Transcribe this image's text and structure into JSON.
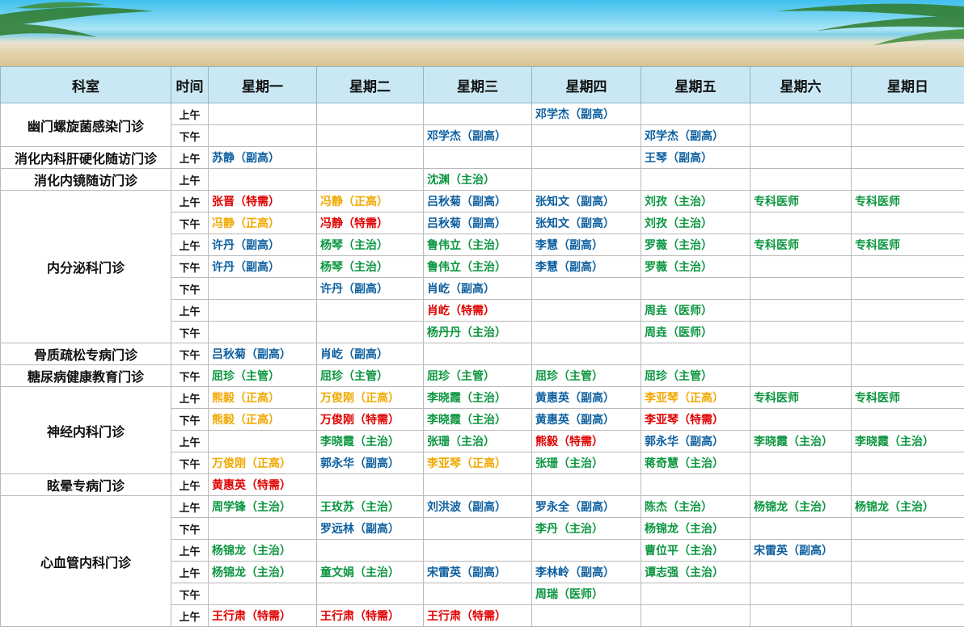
{
  "colors": {
    "red": "#e00000",
    "blue": "#0c5f9f",
    "green": "#0c9640",
    "gold": "#f0a800",
    "header_bg": "#c9e8f3"
  },
  "headers": [
    "科室",
    "时间",
    "星期一",
    "星期二",
    "星期三",
    "星期四",
    "星期五",
    "星期六",
    "星期日"
  ],
  "departments": [
    {
      "name": "幽门螺旋菌感染门诊",
      "rows": [
        {
          "time": "上午",
          "cells": [
            null,
            null,
            null,
            [
              "邓学杰（副高）",
              "blue"
            ],
            null,
            null,
            null
          ]
        },
        {
          "time": "下午",
          "cells": [
            null,
            null,
            [
              "邓学杰（副高）",
              "blue"
            ],
            null,
            [
              "邓学杰（副高）",
              "blue"
            ],
            null,
            null
          ]
        }
      ]
    },
    {
      "name": "消化内科肝硬化随访门诊",
      "rows": [
        {
          "time": "上午",
          "cells": [
            [
              "苏静（副高）",
              "blue"
            ],
            null,
            null,
            null,
            [
              "王琴（副高）",
              "blue"
            ],
            null,
            null
          ]
        }
      ]
    },
    {
      "name": "消化内镜随访门诊",
      "rows": [
        {
          "time": "上午",
          "cells": [
            null,
            null,
            [
              "沈渊（主治）",
              "green"
            ],
            null,
            null,
            null,
            null
          ]
        }
      ]
    },
    {
      "name": "内分泌科门诊",
      "rows": [
        {
          "time": "上午",
          "cells": [
            [
              "张晋（特需）",
              "red"
            ],
            [
              "冯静（正高）",
              "gold"
            ],
            [
              "吕秋菊（副高）",
              "blue"
            ],
            [
              "张知文（副高）",
              "blue"
            ],
            [
              "刘孜（主治）",
              "green"
            ],
            [
              "专科医师",
              "green"
            ],
            [
              "专科医师",
              "green"
            ]
          ]
        },
        {
          "time": "下午",
          "cells": [
            [
              "冯静（正高）",
              "gold"
            ],
            [
              "冯静（特需）",
              "red"
            ],
            [
              "吕秋菊（副高）",
              "blue"
            ],
            [
              "张知文（副高）",
              "blue"
            ],
            [
              "刘孜（主治）",
              "green"
            ],
            null,
            null
          ]
        },
        {
          "time": "上午",
          "cells": [
            [
              "许丹（副高）",
              "blue"
            ],
            [
              "杨琴（主治）",
              "green"
            ],
            [
              "鲁伟立（主治）",
              "green"
            ],
            [
              "李慧（副高）",
              "blue"
            ],
            [
              "罗薇（主治）",
              "green"
            ],
            [
              "专科医师",
              "green"
            ],
            [
              "专科医师",
              "green"
            ]
          ]
        },
        {
          "time": "下午",
          "cells": [
            [
              "许丹（副高）",
              "blue"
            ],
            [
              "杨琴（主治）",
              "green"
            ],
            [
              "鲁伟立（主治）",
              "green"
            ],
            [
              "李慧（副高）",
              "blue"
            ],
            [
              "罗薇（主治）",
              "green"
            ],
            null,
            null
          ]
        },
        {
          "time": "下午",
          "cells": [
            null,
            [
              "许丹（副高）",
              "blue"
            ],
            [
              "肖屹（副高）",
              "blue"
            ],
            null,
            null,
            null,
            null
          ]
        },
        {
          "time": "上午",
          "cells": [
            null,
            null,
            [
              "肖屹（特需）",
              "red"
            ],
            null,
            [
              "周垚（医师）",
              "green"
            ],
            null,
            null
          ]
        },
        {
          "time": "下午",
          "cells": [
            null,
            null,
            [
              "杨丹丹（主治）",
              "green"
            ],
            null,
            [
              "周垚（医师）",
              "green"
            ],
            null,
            null
          ]
        }
      ]
    },
    {
      "name": "骨质疏松专病门诊",
      "rows": [
        {
          "time": "下午",
          "cells": [
            [
              "吕秋菊（副高）",
              "blue"
            ],
            [
              "肖屹（副高）",
              "blue"
            ],
            null,
            null,
            null,
            null,
            null
          ]
        }
      ]
    },
    {
      "name": "糖尿病健康教育门诊",
      "rows": [
        {
          "time": "下午",
          "cells": [
            [
              "屈珍（主管）",
              "green"
            ],
            [
              "屈珍（主管）",
              "green"
            ],
            [
              "屈珍（主管）",
              "green"
            ],
            [
              "屈珍（主管）",
              "green"
            ],
            [
              "屈珍（主管）",
              "green"
            ],
            null,
            null
          ]
        }
      ]
    },
    {
      "name": "神经内科门诊",
      "rows": [
        {
          "time": "上午",
          "cells": [
            [
              "熊毅（正高）",
              "gold"
            ],
            [
              "万俊刚（正高）",
              "gold"
            ],
            [
              "李晓霞（主治）",
              "green"
            ],
            [
              "黄惠英（副高）",
              "blue"
            ],
            [
              "李亚琴（正高）",
              "gold"
            ],
            [
              "专科医师",
              "green"
            ],
            [
              "专科医师",
              "green"
            ]
          ]
        },
        {
          "time": "下午",
          "cells": [
            [
              "熊毅（正高）",
              "gold"
            ],
            [
              "万俊刚（特需）",
              "red"
            ],
            [
              "李晓霞（主治）",
              "green"
            ],
            [
              "黄惠英（副高）",
              "blue"
            ],
            [
              "李亚琴（特需）",
              "red"
            ],
            null,
            null
          ]
        },
        {
          "time": "上午",
          "cells": [
            null,
            [
              "李晓霞（主治）",
              "green"
            ],
            [
              "张珊（主治）",
              "green"
            ],
            [
              "熊毅（特需）",
              "red"
            ],
            [
              "郭永华（副高）",
              "blue"
            ],
            [
              "李晓霞（主治）",
              "green"
            ],
            [
              "李晓霞（主治）",
              "green"
            ]
          ]
        },
        {
          "time": "下午",
          "cells": [
            [
              "万俊刚（正高）",
              "gold"
            ],
            [
              "郭永华（副高）",
              "blue"
            ],
            [
              "李亚琴（正高）",
              "gold"
            ],
            [
              "张珊（主治）",
              "green"
            ],
            [
              "蒋奇慧（主治）",
              "green"
            ],
            null,
            null
          ]
        }
      ]
    },
    {
      "name": "眩晕专病门诊",
      "rows": [
        {
          "time": "上午",
          "cells": [
            [
              "黄惠英（特需）",
              "red"
            ],
            null,
            null,
            null,
            null,
            null,
            null
          ]
        }
      ]
    },
    {
      "name": "心血管内科门诊",
      "rows": [
        {
          "time": "上午",
          "cells": [
            [
              "周学锋（主治）",
              "green"
            ],
            [
              "王玫苏（主治）",
              "green"
            ],
            [
              "刘洪波（副高）",
              "blue"
            ],
            [
              "罗永全（副高）",
              "blue"
            ],
            [
              "陈杰（主治）",
              "green"
            ],
            [
              "杨锦龙（主治）",
              "green"
            ],
            [
              "杨锦龙（主治）",
              "green"
            ]
          ]
        },
        {
          "time": "下午",
          "cells": [
            null,
            [
              "罗远林（副高）",
              "blue"
            ],
            null,
            [
              "李丹（主治）",
              "green"
            ],
            [
              "杨锦龙（主治）",
              "green"
            ],
            null,
            null
          ]
        },
        {
          "time": "上午",
          "cells": [
            [
              "杨锦龙（主治）",
              "green"
            ],
            null,
            null,
            null,
            [
              "曹位平（主治）",
              "green"
            ],
            [
              "宋雷英（副高）",
              "blue"
            ],
            null
          ]
        },
        {
          "time": "上午",
          "cells": [
            [
              "杨锦龙（主治）",
              "green"
            ],
            [
              "童文娟（主治）",
              "green"
            ],
            [
              "宋雷英（副高）",
              "blue"
            ],
            [
              "李林岭（副高）",
              "blue"
            ],
            [
              "谭志强（主治）",
              "green"
            ],
            null,
            null
          ]
        },
        {
          "time": "下午",
          "cells": [
            null,
            null,
            null,
            [
              "周瑞（医师）",
              "green"
            ],
            null,
            null,
            null
          ]
        },
        {
          "time": "上午",
          "cells": [
            [
              "王行肃（特需）",
              "red"
            ],
            [
              "王行肃（特需）",
              "red"
            ],
            [
              "王行肃（特需）",
              "red"
            ],
            null,
            null,
            null,
            null
          ]
        }
      ]
    }
  ]
}
